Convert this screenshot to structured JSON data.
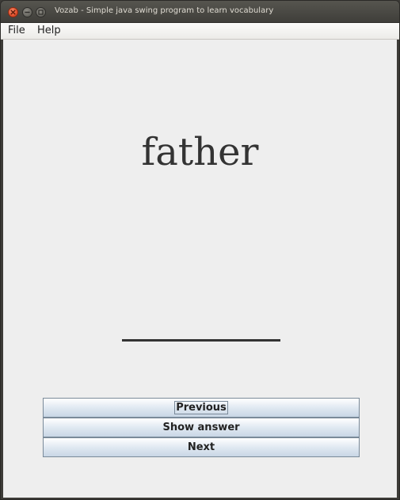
{
  "window": {
    "title": "Vozab - Simple java swing program to learn vocabulary"
  },
  "menu": {
    "file": "File",
    "help": "Help"
  },
  "card": {
    "word": "father"
  },
  "buttons": {
    "previous": "Previous",
    "show_answer": "Show answer",
    "next": "Next"
  },
  "colors": {
    "titlebar": "#3c3b37",
    "close_button": "#e2502d",
    "content_bg": "#eeeeee",
    "button_border": "#7a8a99"
  },
  "icons": {
    "close": "close-icon",
    "minimize": "minimize-icon",
    "maximize": "maximize-icon"
  }
}
